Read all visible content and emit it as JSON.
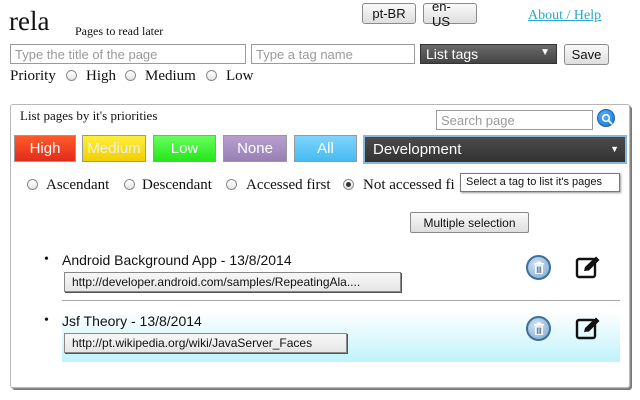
{
  "header": {
    "app_name": "rela",
    "subtitle": "Pages to read later",
    "lang_pt": "pt-BR",
    "lang_en": "en-US",
    "help_link": "About / Help"
  },
  "form": {
    "title_placeholder": "Type the title of the page",
    "tag_placeholder": "Type a tag name",
    "tag_select_value": "List tags",
    "save_label": "Save",
    "priority_label": "Priority",
    "priority_options": [
      "High",
      "Medium",
      "Low"
    ]
  },
  "panel": {
    "title": "List pages by it's priorities",
    "search_placeholder": "Search page",
    "priority_buttons": [
      "High",
      "Medium",
      "Low",
      "None",
      "All"
    ],
    "tag_dropdown_value": "Development",
    "tooltip": "Select a tag to list it's pages",
    "sort_options": [
      "Ascendant",
      "Descendant",
      "Accessed first",
      "Not accessed fi"
    ],
    "sort_selected": 3,
    "multiple_selection": "Multiple selection"
  },
  "pages": [
    {
      "title": "Android Background App - 13/8/2014",
      "url": "http://developer.android.com/samples/RepeatingAla...."
    },
    {
      "title": "Jsf Theory - 13/8/2014",
      "url": "http://pt.wikipedia.org/wiki/JavaServer_Faces"
    }
  ],
  "colors": {
    "high": "#e32b1b",
    "medium": "#f1cf00",
    "low": "#25e61a",
    "none": "#9880b5",
    "all": "#45bbf2",
    "link": "#2aa6c8",
    "selected_row": "#bff3fb"
  }
}
